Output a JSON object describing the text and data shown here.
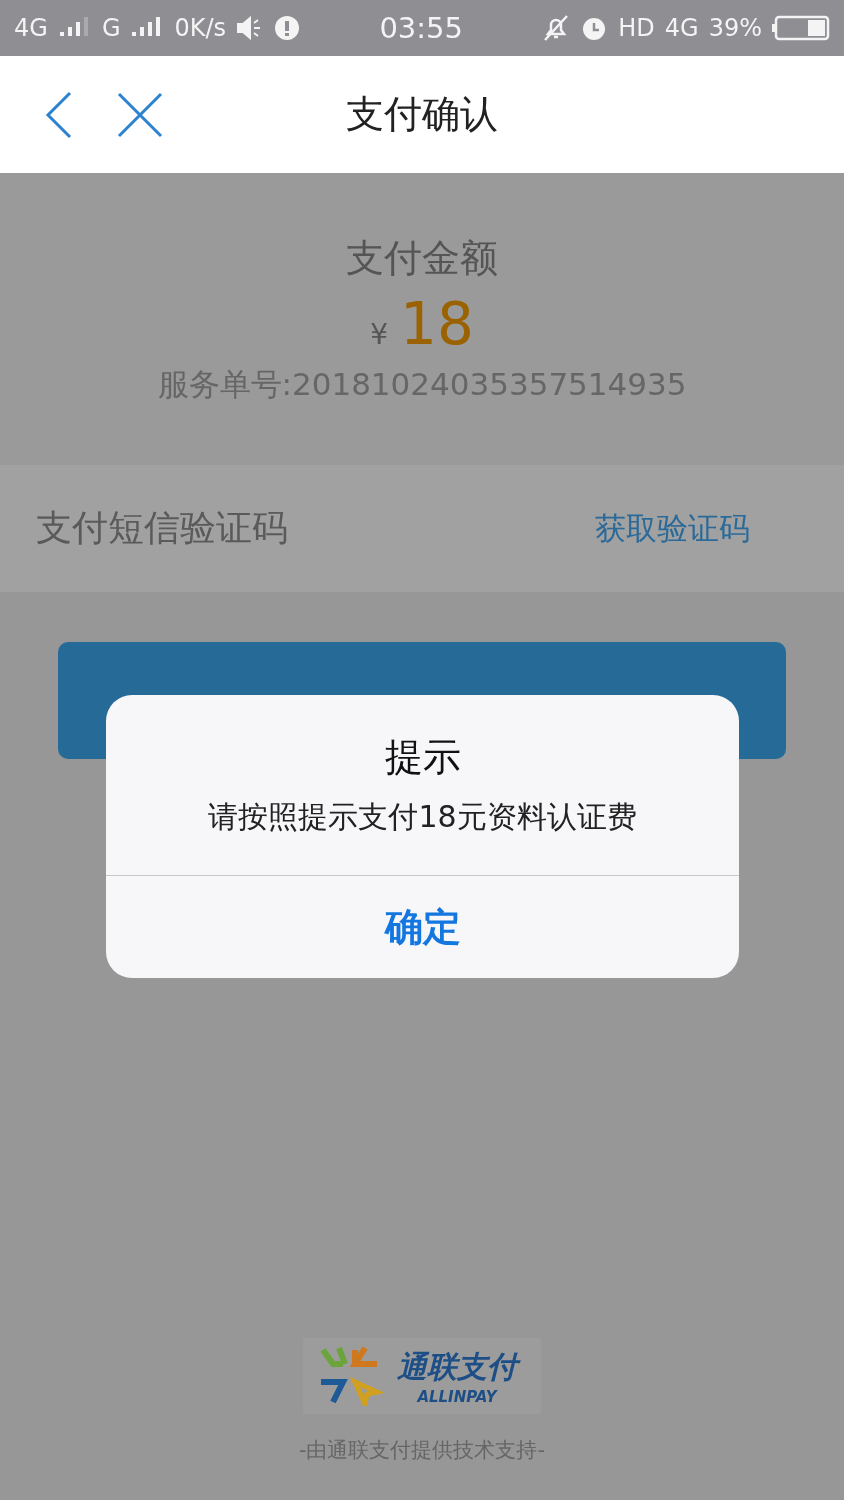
{
  "status_bar": {
    "network_1": "4G",
    "network_2": "G",
    "speed": "0K/s",
    "time": "03:55",
    "hd": "HD",
    "network_3": "4G",
    "battery": "39%"
  },
  "header": {
    "title": "支付确认"
  },
  "payment": {
    "label": "支付金额",
    "currency": "¥",
    "amount": "18",
    "order": "服务单号:20181024035357514935"
  },
  "sms": {
    "label": "支付短信验证码",
    "action": "获取验证码"
  },
  "dialog": {
    "title": "提示",
    "message": "请按照提示支付18元资料认证费",
    "button": "确定"
  },
  "footer": {
    "logo_cn": "通联支付",
    "logo_en": "ALLINPAY",
    "credit": "-由通联支付提供技术支持-"
  }
}
